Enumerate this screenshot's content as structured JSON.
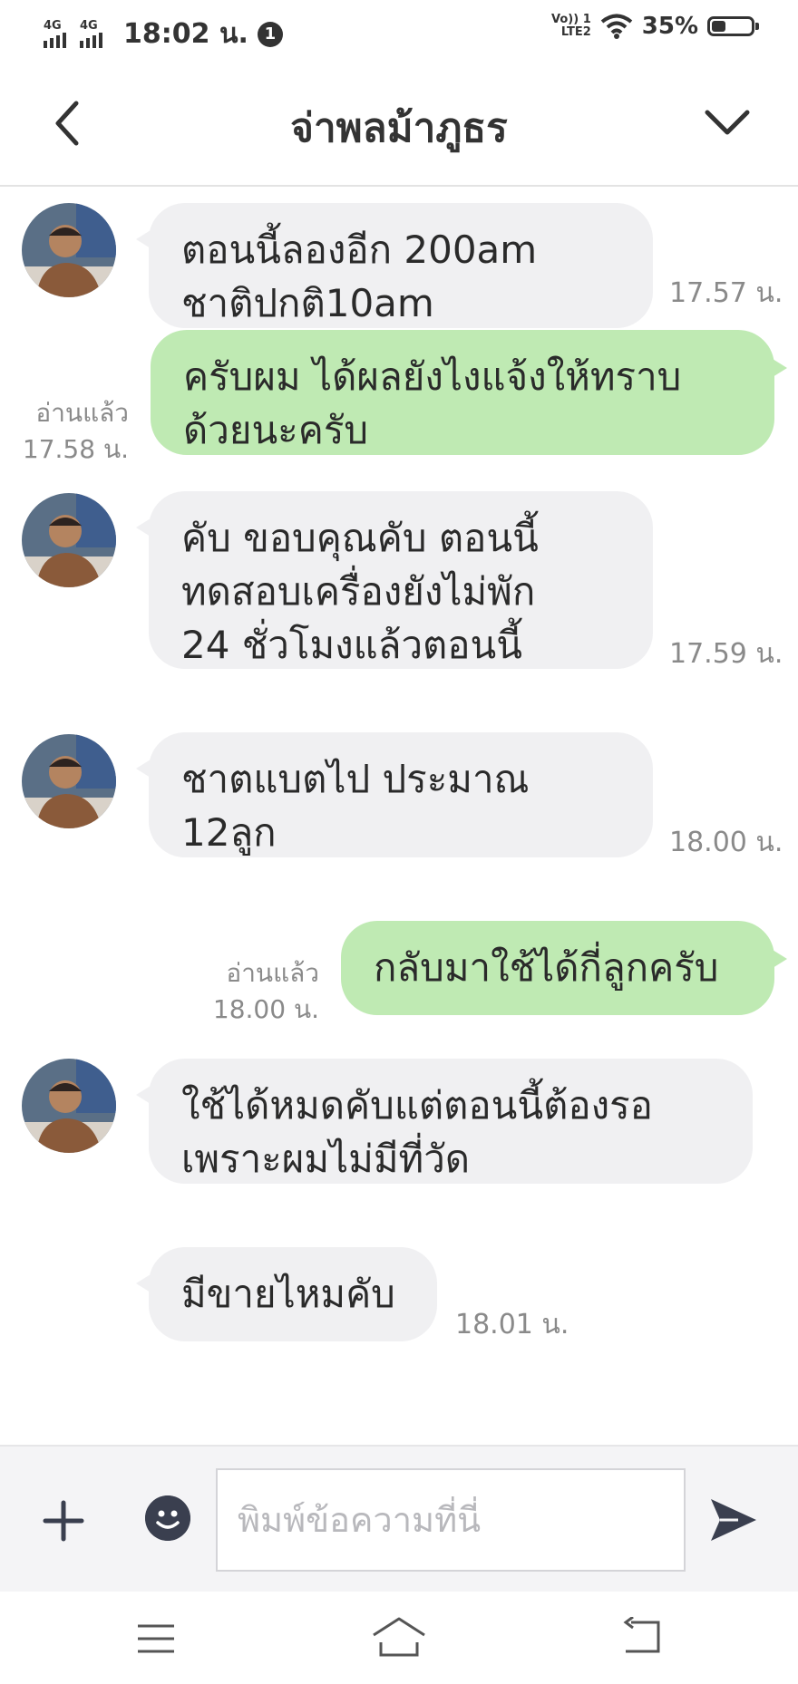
{
  "status_bar": {
    "network1": "4G",
    "network2": "4G",
    "time": "18:02 น.",
    "notification_count": "1",
    "volte_line1": "Vo)) 1",
    "volte_line2": "LTE2",
    "battery_percent": "35%",
    "battery_level": 0.35
  },
  "header": {
    "contact_name": "จ่าพลม้าภูธร",
    "back_icon": "chevron-left-icon",
    "menu_icon": "chevron-down-icon"
  },
  "messages": [
    {
      "direction": "in",
      "text": "ตอนนี้ลองอีก 200am\nชาติปกติ10am",
      "time": "17.57 น."
    },
    {
      "direction": "out",
      "text": "ครับผม ได้ผลยังไงแจ้งให้ทราบ\nด้วยนะครับ",
      "read": "อ่านแล้ว",
      "time": "17.58 น."
    },
    {
      "direction": "in",
      "text": "คับ ขอบคุณคับ ตอนนี้\nทดสอบเครื่องยังไม่พัก\n24 ชั่วโมงแล้วตอนนี้",
      "time": "17.59 น."
    },
    {
      "direction": "in",
      "text": "ชาตแบตไป ประมาณ\n12ลูก",
      "time": "18.00 น."
    },
    {
      "direction": "out",
      "text": "กลับมาใช้ได้กี่ลูกครับ",
      "read": "อ่านแล้ว",
      "time": "18.00 น."
    },
    {
      "direction": "in",
      "text": "ใช้ได้หมดคับแต่ตอนนี้ต้องรอ\nเพราะผมไม่มีที่วัด",
      "time": ""
    },
    {
      "direction": "in",
      "text": "มีขายไหมคับ",
      "time": "18.01 น."
    }
  ],
  "input_bar": {
    "placeholder": "พิมพ์ข้อความที่นี่",
    "value": "",
    "add_icon": "plus-icon",
    "emoji_icon": "smiley-icon",
    "send_icon": "send-icon"
  },
  "nav_bar": {
    "menu_icon": "menu-icon",
    "home_icon": "home-icon",
    "back_icon": "back-arrow-icon"
  },
  "colors": {
    "incoming_bubble": "#f0f0f2",
    "outgoing_bubble": "#bfeab3",
    "meta_text": "#8a8a8a",
    "accent_dark": "#3a3f4f"
  }
}
